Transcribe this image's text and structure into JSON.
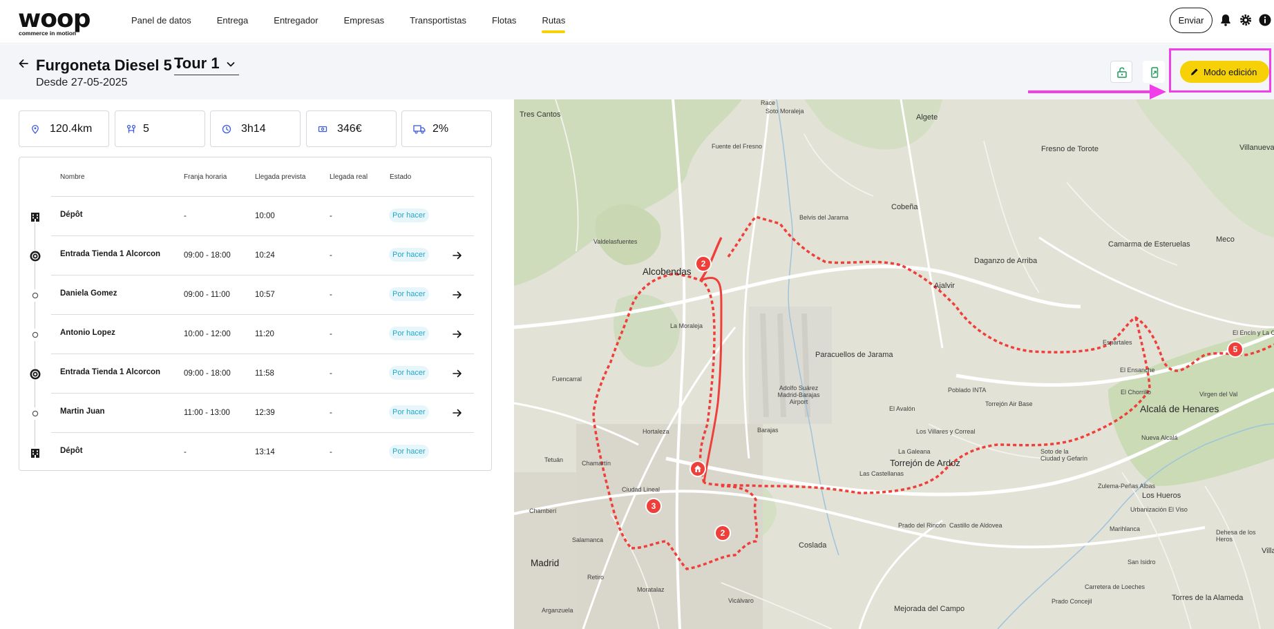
{
  "brand": {
    "name": "woop",
    "tagline": "commerce in motion"
  },
  "nav": {
    "items": [
      {
        "label": "Panel de datos",
        "active": false
      },
      {
        "label": "Entrega",
        "active": false
      },
      {
        "label": "Entregador",
        "active": false
      },
      {
        "label": "Empresas",
        "active": false
      },
      {
        "label": "Transportistas",
        "active": false
      },
      {
        "label": "Flotas",
        "active": false
      },
      {
        "label": "Rutas",
        "active": true
      }
    ],
    "send_label": "Enviar",
    "accent_color": "#f6d108"
  },
  "header": {
    "title": "Furgoneta Diesel 5 -",
    "tour": "Tour 1",
    "since": "Desde 27-05-2025",
    "edit_mode_label": "Modo edición"
  },
  "stats": {
    "distance": "120.4km",
    "stops": "5",
    "duration": "3h14",
    "cost": "346€",
    "load": "2%"
  },
  "table": {
    "columns": [
      "Nombre",
      "Franja horaria",
      "Llegada prevista",
      "Llegada real",
      "Estado"
    ],
    "rows": [
      {
        "icon": "depot-icon",
        "name": "Dépôt",
        "window": "-",
        "eta": "10:00",
        "actual": "-",
        "status": "Por hacer",
        "has_arrow": false
      },
      {
        "icon": "pickup-icon",
        "name": "Entrada Tienda 1 Alcorcon",
        "window": "09:00 - 18:00",
        "eta": "10:24",
        "actual": "-",
        "status": "Por hacer",
        "has_arrow": true
      },
      {
        "icon": "stop-dot-icon",
        "name": "Daniela Gomez",
        "window": "09:00 - 11:00",
        "eta": "10:57",
        "actual": "-",
        "status": "Por hacer",
        "has_arrow": true
      },
      {
        "icon": "stop-dot-icon",
        "name": "Antonio Lopez",
        "window": "10:00 - 12:00",
        "eta": "11:20",
        "actual": "-",
        "status": "Por hacer",
        "has_arrow": true
      },
      {
        "icon": "pickup-icon",
        "name": "Entrada Tienda 1 Alcorcon",
        "window": "09:00 - 18:00",
        "eta": "11:58",
        "actual": "-",
        "status": "Por hacer",
        "has_arrow": true
      },
      {
        "icon": "stop-dot-icon",
        "name": "Martin Juan",
        "window": "11:00 - 13:00",
        "eta": "12:39",
        "actual": "-",
        "status": "Por hacer",
        "has_arrow": true
      },
      {
        "icon": "depot-icon",
        "name": "Dépôt",
        "window": "-",
        "eta": "13:14",
        "actual": "-",
        "status": "Por hacer",
        "has_arrow": false
      }
    ],
    "status_color": "#22a6c8"
  },
  "map": {
    "route_color": "#ee3f3a",
    "markers": [
      "2",
      "3",
      "2",
      "5"
    ],
    "labels": {
      "race": "Race",
      "soto": "Soto Moraleja",
      "tres_cantos": "Tres Cantos",
      "fuente_fresno": "Fuente del Fresno",
      "algete": "Algete",
      "fresno_torote": "Fresno de Torote",
      "villanueva": "Villanueva d",
      "belvis": "Belvis del Jarama",
      "cobena": "Cobeña",
      "valdelasfuentes": "Valdelasfuentes",
      "alcobendas": "Alcobendas",
      "daganzo": "Daganzo de Arriba",
      "camarma": "Camarma de Esteruelas",
      "meco": "Meco",
      "ajalvir": "Ajalvir",
      "moraleja": "La Moraleja",
      "paracuellos": "Paracuellos de Jarama",
      "espartales": "Espartales",
      "encin": "El Encín y La Canaleja",
      "fuencarral": "Fuencarral",
      "adolfo": "Adolfo Suárez Madrid-Barajas Airport",
      "poblado": "Poblado INTA",
      "torrejon_base": "Torrejón Air Base",
      "ensanche": "El Ensanche",
      "chorrillo": "El Chorrillo",
      "virgen": "Virgen del Val",
      "alcala": "Alcalá de Henares",
      "avalon": "El Avalón",
      "barajas": "Barajas",
      "villares": "Los Villares y Correal",
      "nueva_alcala": "Nueva Alcalá",
      "hortaleza": "Hortaleza",
      "galeana": "La Galeana",
      "torrejon": "Torrejón de Ardoz",
      "soto_ciudad": "Soto de la Ciudad y Gefarín",
      "tetuan": "Tetuán",
      "chamartin": "Chamartín",
      "castellanas": "Las Castellanas",
      "zulema": "Zulema-Peñas Albas",
      "ciudad_lineal": "Ciudad Lineal",
      "los_hueros": "Los Hueros",
      "chamberi": "Chamberí",
      "urbanizacion": "Urbanización El Viso",
      "prado_rincon": "Prado del Rincón",
      "castillo": "Castillo de Aldovea",
      "marihlanca": "Marihlanca",
      "dehesa": "Dehesa de los Heros",
      "salamanca": "Salamanca",
      "coslada": "Coslada",
      "san_isidro": "San Isidro",
      "villalbi": "Villalbi",
      "madrid": "Madrid",
      "retiro": "Retiro",
      "carretera": "Carretera de Loeches",
      "moratalaz": "Moratalaz",
      "prado_concejil": "Prado Concejil",
      "torres": "Torres de la Alameda",
      "arganzuela": "Arganzuela",
      "vicalvaro": "Vicálvaro",
      "mejorada": "Mejorada del Campo"
    }
  }
}
